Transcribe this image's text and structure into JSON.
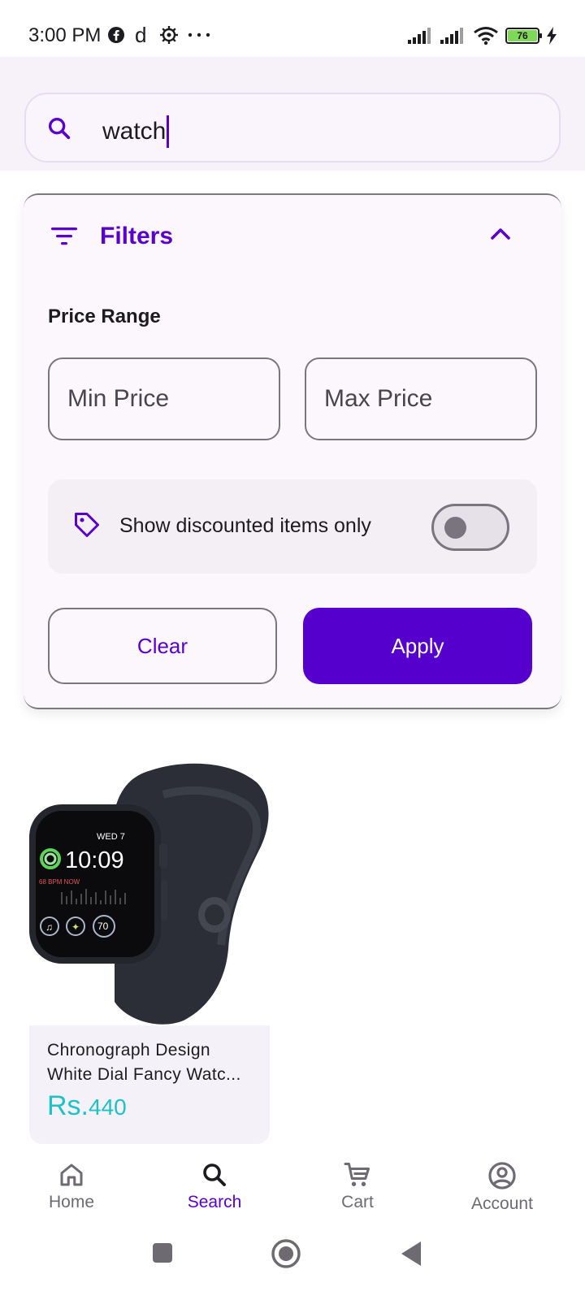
{
  "status_bar": {
    "time": "3:00 PM",
    "left_icons": [
      "facebook-icon",
      "d-app-icon",
      "settings-gear-icon",
      "more-dots-icon"
    ],
    "battery_level": "76"
  },
  "search": {
    "value": "watch",
    "icon": "search-icon"
  },
  "filters": {
    "title": "Filters",
    "expanded": true,
    "price_range_label": "Price Range",
    "min_price_placeholder": "Min Price",
    "max_price_placeholder": "Max Price",
    "discount_label": "Show discounted items only",
    "discount_only": false,
    "clear_label": "Clear",
    "apply_label": "Apply"
  },
  "products": [
    {
      "name": "Chronograph Design White Dial Fancy Watc...",
      "currency": "Rs.",
      "price": "440",
      "image": {
        "watch_day": "WED 7",
        "watch_time": "10:09",
        "watch_bpm": "68 BPM NOW",
        "watch_complication": "70"
      }
    }
  ],
  "bottom_nav": {
    "items": [
      {
        "label": "Home",
        "icon": "home-icon",
        "active": false
      },
      {
        "label": "Search",
        "icon": "search-icon",
        "active": true
      },
      {
        "label": "Cart",
        "icon": "cart-icon",
        "active": false
      },
      {
        "label": "Account",
        "icon": "account-circle-icon",
        "active": false
      }
    ]
  },
  "colors": {
    "accent": "#5500cc",
    "price": "#1fc1c9",
    "surface": "#f7f2fa"
  }
}
